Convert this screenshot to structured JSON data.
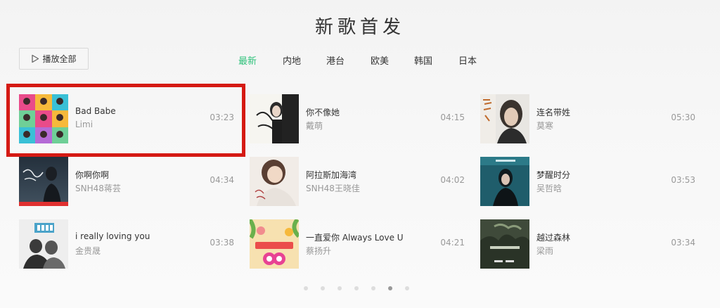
{
  "title": "新歌首发",
  "play_all": {
    "label": "播放全部",
    "icon": "play-icon"
  },
  "tabs": [
    {
      "label": "最新",
      "active": true
    },
    {
      "label": "内地",
      "active": false
    },
    {
      "label": "港台",
      "active": false
    },
    {
      "label": "欧美",
      "active": false
    },
    {
      "label": "韩国",
      "active": false
    },
    {
      "label": "日本",
      "active": false
    }
  ],
  "accent_color": "#31c27c",
  "highlight_color": "#d51a14",
  "songs": [
    {
      "name": "Bad Babe",
      "singer": "Limi",
      "duration": "03:23"
    },
    {
      "name": "你不像她",
      "singer": "戴萌",
      "duration": "04:15"
    },
    {
      "name": "连名带姓",
      "singer": "莫寒",
      "duration": "05:30"
    },
    {
      "name": "你啊你啊",
      "singer": "SNH48蒋芸",
      "duration": "04:34"
    },
    {
      "name": "阿拉斯加海湾",
      "singer": "SNH48王晓佳",
      "duration": "04:02"
    },
    {
      "name": "梦醒时分",
      "singer": "吴哲晗",
      "duration": "03:53"
    },
    {
      "name": "i really loving you",
      "singer": "金贵晟",
      "duration": "03:38"
    },
    {
      "name": "一直爱你 Always Love U",
      "singer": "蔡扬升",
      "duration": "04:21"
    },
    {
      "name": "越过森林",
      "singer": "梁雨",
      "duration": "03:34"
    }
  ],
  "pagination": {
    "pages": 7,
    "current": 6
  }
}
